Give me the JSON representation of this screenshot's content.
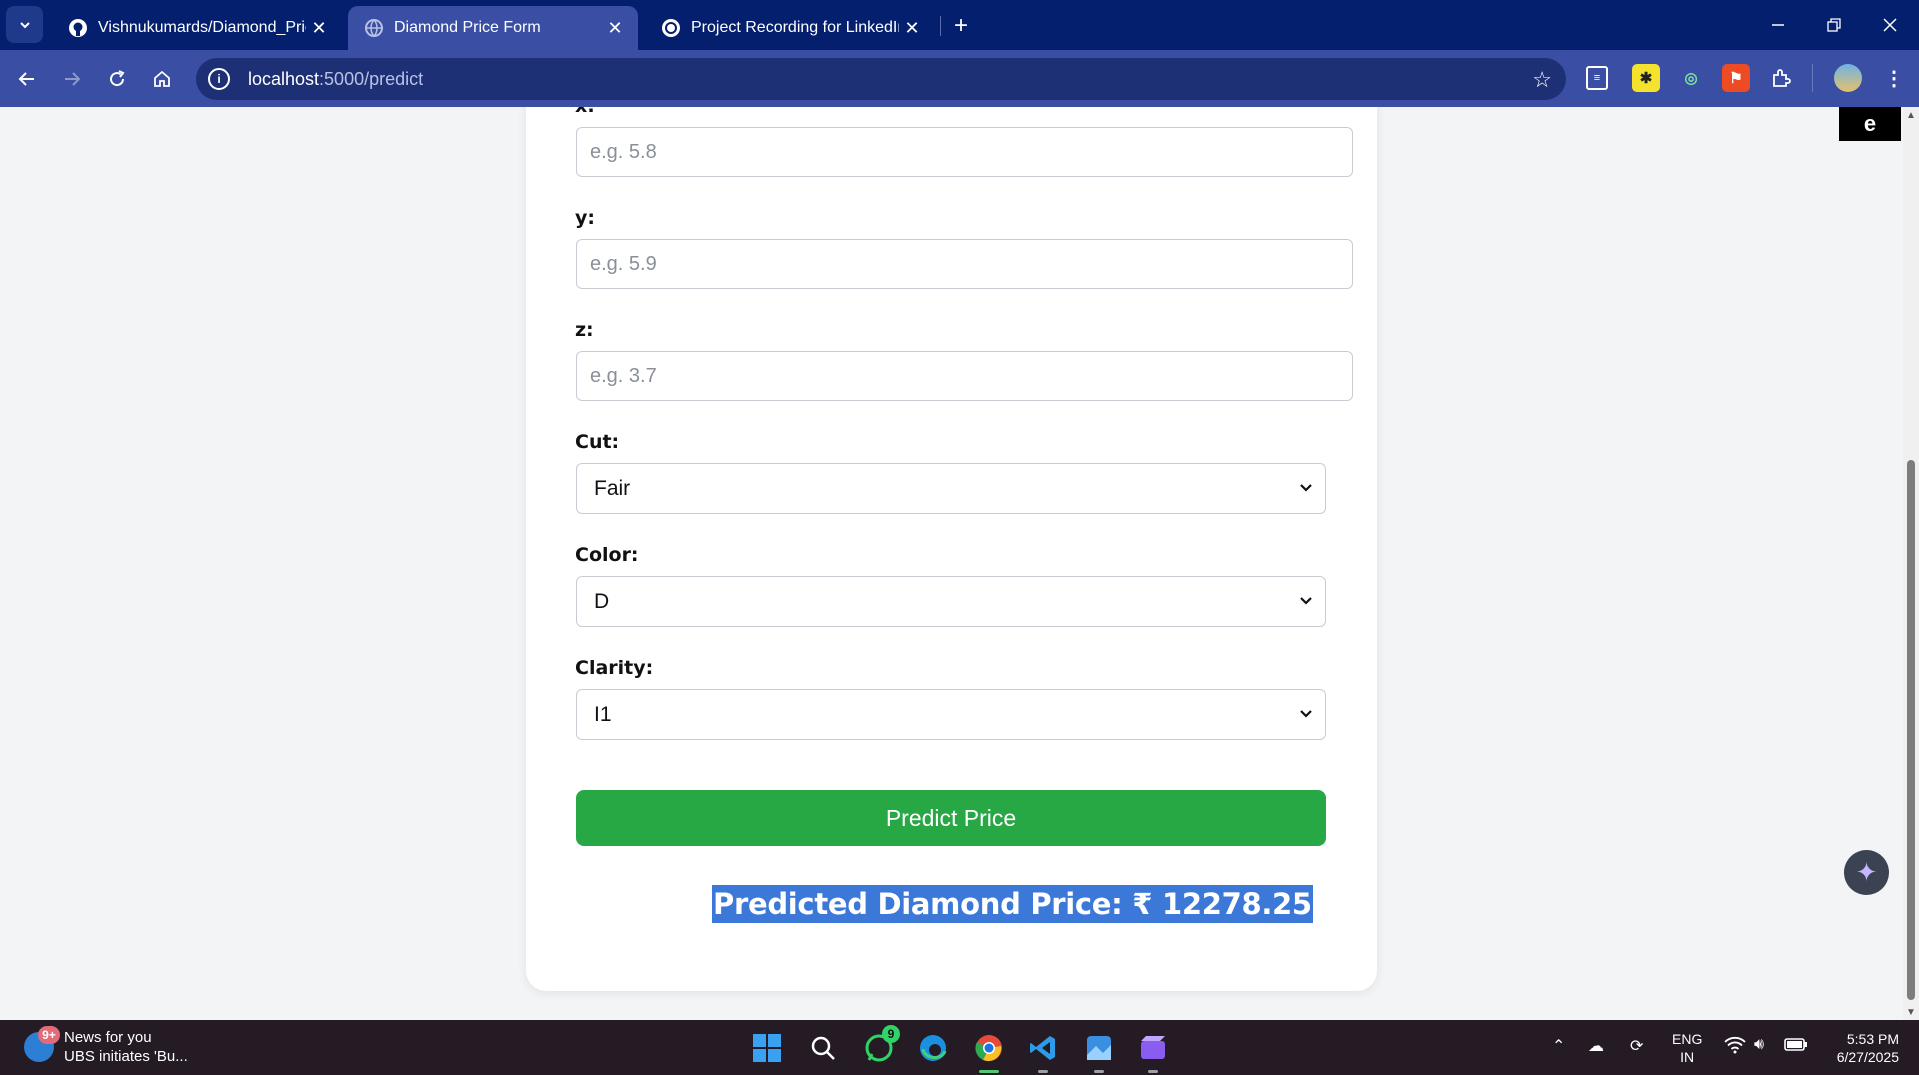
{
  "browser": {
    "tabs": [
      {
        "title": "Vishnukumards/Diamond_Price",
        "favicon": "github-icon"
      },
      {
        "title": "Diamond Price Form",
        "favicon": "globe-icon"
      },
      {
        "title": "Project Recording for LinkedIn",
        "favicon": "chatgpt-icon"
      }
    ],
    "url_host": "localhost",
    "url_path": ":5000/predict"
  },
  "form": {
    "x_label": "x:",
    "x_placeholder": "e.g. 5.8",
    "y_label": "y:",
    "y_placeholder": "e.g. 5.9",
    "z_label": "z:",
    "z_placeholder": "e.g. 3.7",
    "cut_label": "Cut:",
    "cut_value": "Fair",
    "color_label": "Color:",
    "color_value": "D",
    "clarity_label": "Clarity:",
    "clarity_value": "I1",
    "submit_label": "Predict Price",
    "result_text": "Predicted Diamond Price: ₹ 12278.25"
  },
  "taskbar": {
    "news_badge": "9+",
    "news_title": "News for you",
    "news_subtitle": "UBS initiates 'Bu...",
    "whatsapp_badge": "9",
    "lang_line1": "ENG",
    "lang_line2": "IN",
    "time": "5:53 PM",
    "date": "6/27/2025"
  },
  "colors": {
    "tabbar": "#041f6e",
    "toolbar": "#3a4fa3",
    "predict_button": "#28a745",
    "result_highlight": "#3b78d8",
    "taskbar": "#241b24"
  }
}
